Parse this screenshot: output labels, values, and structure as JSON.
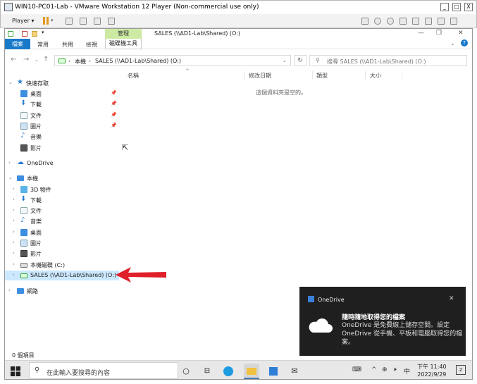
{
  "vm": {
    "title": "WIN10-PC01-Lab - VMware Workstation 12 Player (Non-commercial use only)",
    "player_label": "Player ▾",
    "controls": [
      "_",
      "□",
      "X"
    ]
  },
  "explorer": {
    "window_title": "SALES (\\\\AD1-Lab\\Shared) (O:)",
    "context_tab_group": "管理",
    "ribbon_tabs": [
      "檔案",
      "常用",
      "共用",
      "檢視"
    ],
    "context_tab": "磁碟機工具",
    "window_controls": [
      "—",
      "❐",
      "✕"
    ],
    "breadcrumb": [
      "本機",
      "SALES (\\\\AD1-Lab\\Shared) (O:)"
    ],
    "search_placeholder": "搜尋 SALES (\\\\AD1-Lab\\Shared) (O:)",
    "columns": [
      "名稱",
      "修改日期",
      "類型",
      "大小"
    ],
    "empty_message": "這個資料夾是空的。",
    "status_text": "0 個項目"
  },
  "nav": {
    "quick_access": "快速存取",
    "quick_items": [
      "桌面",
      "下載",
      "文件",
      "圖片",
      "音樂",
      "影片"
    ],
    "onedrive": "OneDrive",
    "this_pc": "本機",
    "pc_items": [
      "3D 物件",
      "下載",
      "文件",
      "音樂",
      "桌面",
      "圖片",
      "影片",
      "本機磁碟 (C:)",
      "SALES (\\\\AD1-Lab\\Shared) (O:)"
    ],
    "network": "網路"
  },
  "toast": {
    "app": "OneDrive",
    "title": "隨時隨地取得您的檔案",
    "body": "OneDrive 是免費線上儲存空間。設定 OneDrive 從手機、平板和電腦取得您的檔案。"
  },
  "taskbar": {
    "search_placeholder": "在此輸入要搜尋的內容",
    "ime": "中",
    "time": "下午 11:40",
    "date": "2022/9/29",
    "notifications": "2"
  },
  "colors": {
    "file_tab": "#1979ca",
    "context_tab": "#cdeaa3",
    "selection": "#cce8ff",
    "annotation_arrow": "#e0202a"
  }
}
